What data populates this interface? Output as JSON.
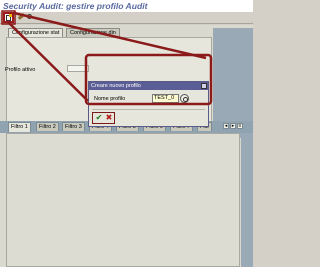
{
  "window": {
    "title": "Security Audit: gestire profilo Audit"
  },
  "toolbar": {
    "create_icon": "create-page-icon",
    "change_icon": "pencil-icon",
    "display_icon": "magnifier-icon"
  },
  "tabs_top": [
    "Configurazione stat",
    "Configurazione din"
  ],
  "fields": {
    "profilo_attivo_label": "Profilo attivo"
  },
  "filter_tabs": [
    "Filtro 1",
    "Filtro 2",
    "Filtro 3",
    "Filtro 4",
    "Filtro 5",
    "Filtro 6",
    "Filtro 7",
    "Filtr"
  ],
  "dialog": {
    "title": "Creare nuovo profilo",
    "label": "Nome profilo",
    "value": "TEST_0",
    "ok_symbol": "✔",
    "cancel_symbol": "✖"
  },
  "colors": {
    "annotation": "#8b1a1a",
    "dialog_titlebar": "#5b5e96",
    "title_text": "#5a6aa0",
    "input_bg": "#fffbd0"
  }
}
